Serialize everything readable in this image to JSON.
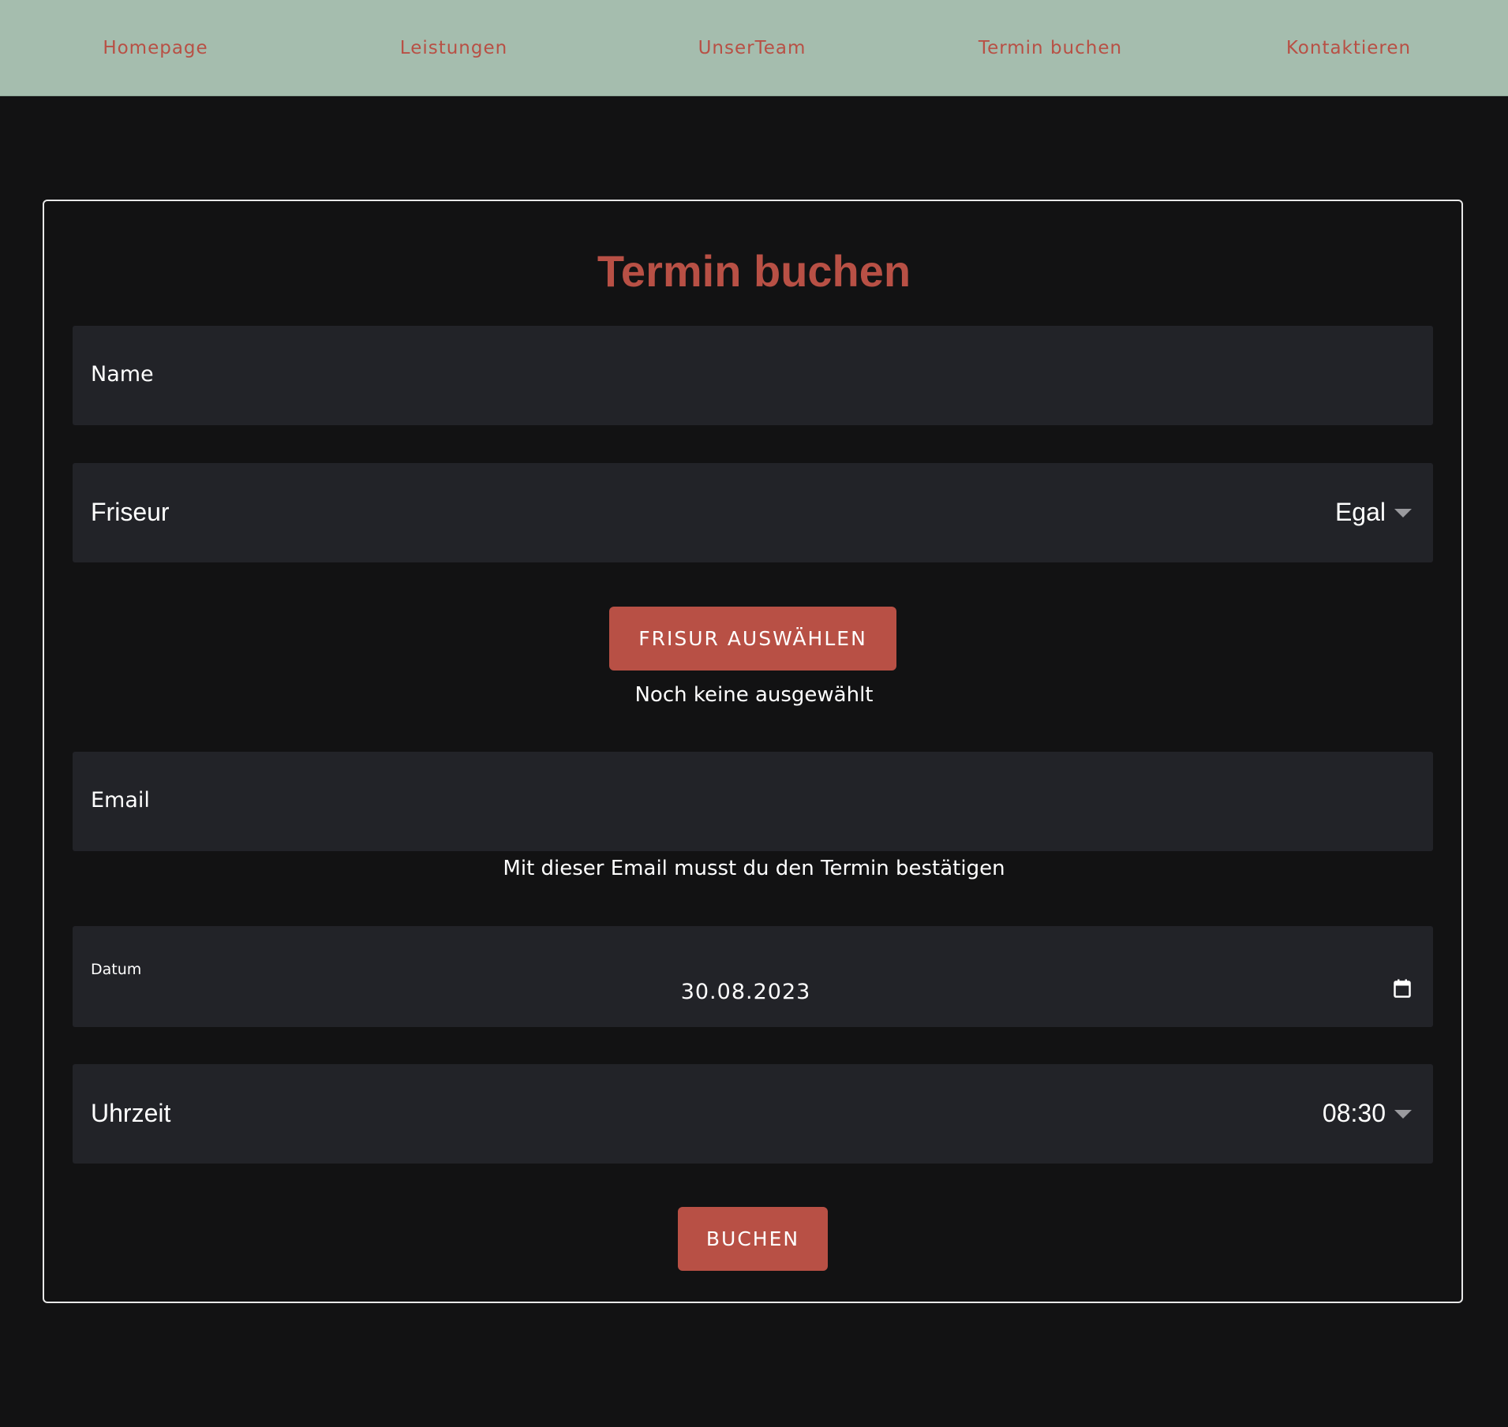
{
  "nav": {
    "items": [
      {
        "label": "Homepage"
      },
      {
        "label": "Leistungen"
      },
      {
        "label": "UnserTeam"
      },
      {
        "label": "Termin buchen"
      },
      {
        "label": "Kontaktieren"
      }
    ]
  },
  "form": {
    "title": "Termin buchen",
    "name_label": "Name",
    "friseur_label": "Friseur",
    "friseur_value": "Egal",
    "frisur_button": "FRISUR AUSWÄHLEN",
    "frisur_status": "Noch keine ausgewählt",
    "email_label": "Email",
    "email_hint": "Mit dieser Email musst du den Termin bestätigen",
    "datum_label": "Datum",
    "datum_value": "30.08.2023",
    "uhrzeit_label": "Uhrzeit",
    "uhrzeit_value": "08:30",
    "submit_button": "BUCHEN"
  },
  "icons": {
    "dropdown": "chevron-down-icon",
    "calendar": "calendar-icon"
  },
  "colors": {
    "nav_background": "#a5bdae",
    "accent": "#b85045",
    "page_background": "#121213",
    "field_background": "#222328"
  }
}
